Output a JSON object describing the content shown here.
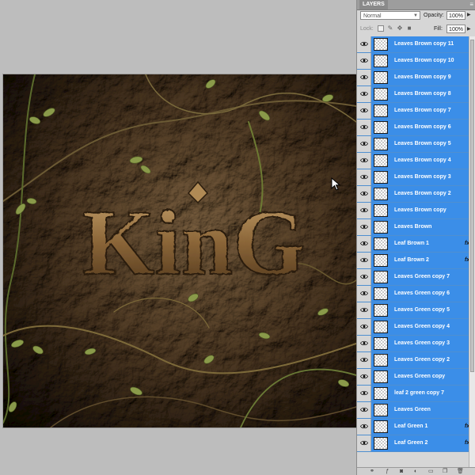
{
  "canvas": {
    "text": "KinG"
  },
  "layers_panel": {
    "tab_label": "LAYERS",
    "menu_icon": "panel-menu-icon",
    "blend_mode": "Normal",
    "opacity_label": "Opacity:",
    "opacity_value": "100%",
    "lock_label": "Lock:",
    "fill_label": "Fill:",
    "fill_value": "100%",
    "selection_color": "#3b8ee8",
    "layers": [
      {
        "name": "Leaves Brown copy 11",
        "fx": ""
      },
      {
        "name": "Leaves Brown copy 10",
        "fx": ""
      },
      {
        "name": "Leaves Brown copy 9",
        "fx": ""
      },
      {
        "name": "Leaves Brown copy 8",
        "fx": ""
      },
      {
        "name": "Leaves Brown copy 7",
        "fx": ""
      },
      {
        "name": "Leaves Brown copy 6",
        "fx": ""
      },
      {
        "name": "Leaves Brown copy 5",
        "fx": ""
      },
      {
        "name": "Leaves Brown copy 4",
        "fx": ""
      },
      {
        "name": "Leaves Brown copy 3",
        "fx": ""
      },
      {
        "name": "Leaves Brown copy 2",
        "fx": ""
      },
      {
        "name": "Leaves Brown copy",
        "fx": ""
      },
      {
        "name": "Leaves Brown",
        "fx": ""
      },
      {
        "name": "Leaf Brown 1",
        "fx": "fx"
      },
      {
        "name": "Leaf Brown 2",
        "fx": "fx"
      },
      {
        "name": "Leaves Green copy 7",
        "fx": ""
      },
      {
        "name": "Leaves Green copy 6",
        "fx": ""
      },
      {
        "name": "Leaves Green copy 5",
        "fx": ""
      },
      {
        "name": "Leaves Green copy 4",
        "fx": ""
      },
      {
        "name": "Leaves Green copy 3",
        "fx": ""
      },
      {
        "name": "Leaves Green copy 2",
        "fx": ""
      },
      {
        "name": "Leaves Green copy",
        "fx": ""
      },
      {
        "name": "leaf 2 green copy 7",
        "fx": ""
      },
      {
        "name": "Leaves Green",
        "fx": ""
      },
      {
        "name": "Leaf Green 1",
        "fx": "fx"
      },
      {
        "name": "Leaf Green 2",
        "fx": "fx"
      }
    ]
  }
}
